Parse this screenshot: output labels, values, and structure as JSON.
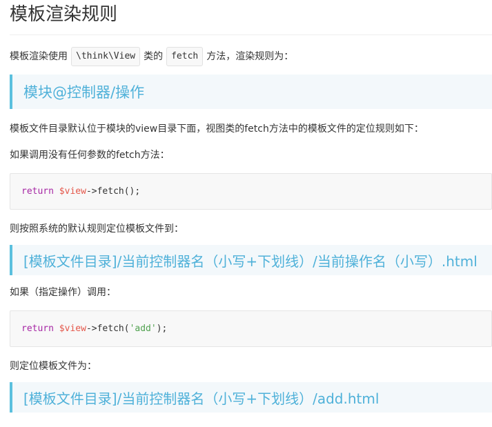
{
  "title": "模板渲染规则",
  "intro": {
    "before": "模板渲染使用",
    "code1": "\\think\\View",
    "middle": "类的",
    "code2": "fetch",
    "after": "方法，渲染规则为："
  },
  "section_heading": "模块@控制器/操作",
  "para1": "模板文件目录默认位于模块的view目录下面，视图类的fetch方法中的模板文件的定位规则如下：",
  "para2": "如果调用没有任何参数的fetch方法：",
  "code_block1": {
    "keyword": "return",
    "variable": "$view",
    "rest": "->fetch();"
  },
  "para3": "则按照系统的默认规则定位模板文件到：",
  "rule1": "[模板文件目录]/当前控制器名（小写+下划线）/当前操作名（小写）.html",
  "para4": "如果（指定操作）调用：",
  "code_block2": {
    "keyword": "return",
    "variable": "$view",
    "rest_before": "->fetch(",
    "string": "'add'",
    "rest_after": ");"
  },
  "para5": "则定位模板文件为：",
  "rule2": "[模板文件目录]/当前控制器名（小写+下划线）/add.html"
}
